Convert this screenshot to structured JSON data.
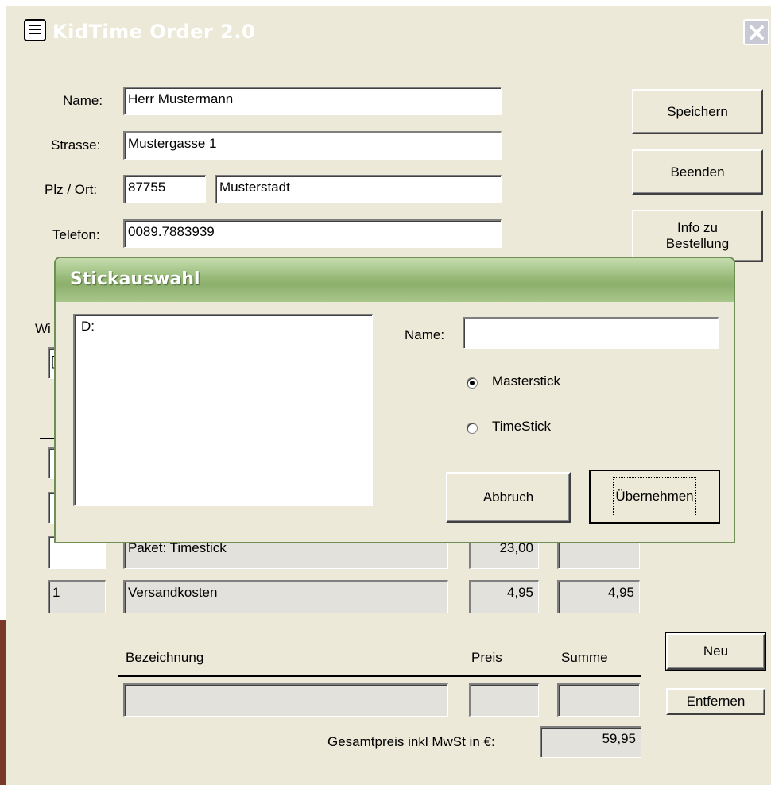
{
  "window": {
    "title": "KidTime Order 2.0",
    "icon": "app-window-icon",
    "close_icon": "close-icon"
  },
  "customer": {
    "name_label": "Name:",
    "name_value": "Herr  Mustermann",
    "street_label": "Strasse:",
    "street_value": "Mustergasse 1",
    "plz_label": "Plz / Ort:",
    "plz_value": "87755",
    "city_value": "Musterstadt",
    "phone_label": "Telefon:",
    "phone_value": "0089.7883939"
  },
  "side_buttons": {
    "save": "Speichern",
    "quit": "Beenden",
    "info_line1": "Info zu",
    "info_line2": "Bestellung"
  },
  "hidden_partial": {
    "label_fragment": "Wi",
    "field_fragment": "["
  },
  "order_rows": [
    {
      "qty": "",
      "desc": "Paket: Timestick",
      "price": "23,00",
      "sum": ""
    },
    {
      "qty": "1",
      "desc": "Versandkosten",
      "price": "4,95",
      "sum": "4,95"
    }
  ],
  "new_row": {
    "col_desc": "Bezeichnung",
    "col_price": "Preis",
    "col_sum": "Summe",
    "desc": "",
    "price": "",
    "sum": ""
  },
  "row_buttons": {
    "new": "Neu",
    "remove": "Entfernen"
  },
  "total": {
    "label": "Gesamtpreis inkl MwSt in €:",
    "value": "59,95"
  },
  "dialog": {
    "title": "Stickauswahl",
    "list_items": [
      "D:"
    ],
    "name_label": "Name:",
    "name_value": "",
    "options": [
      {
        "label": "Masterstick",
        "selected": true
      },
      {
        "label": "TimeStick",
        "selected": false
      }
    ],
    "cancel": "Abbruch",
    "apply": "Übernehmen"
  },
  "colors": {
    "window_bg": "#ece9d8",
    "dialog_title": "#98ba78",
    "readonly_field": "#e3e1dc"
  }
}
